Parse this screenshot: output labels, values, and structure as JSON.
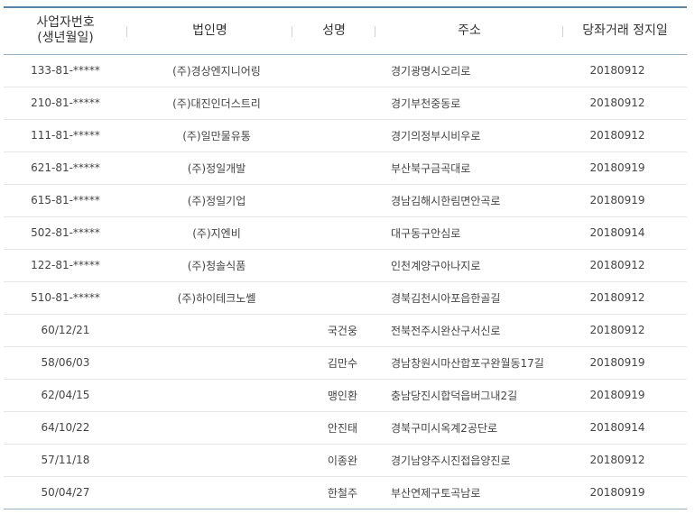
{
  "table": {
    "headers": {
      "biz_no_line1": "사업자번호",
      "biz_no_line2": "(생년월일)",
      "corp_name": "법인명",
      "person_name": "성명",
      "address": "주소",
      "suspend_date": "당좌거래 정지일"
    },
    "rows": [
      {
        "biz_no": "133-81-*****",
        "corp": "(주)경상엔지니어링",
        "name": "",
        "addr": "경기광명시오리로",
        "date": "20180912"
      },
      {
        "biz_no": "210-81-*****",
        "corp": "(주)대진인더스트리",
        "name": "",
        "addr": "경기부천중동로",
        "date": "20180912"
      },
      {
        "biz_no": "111-81-*****",
        "corp": "(주)일만물유통",
        "name": "",
        "addr": "경기의정부시비우로",
        "date": "20180912"
      },
      {
        "biz_no": "621-81-*****",
        "corp": "(주)정일개발",
        "name": "",
        "addr": "부산북구금곡대로",
        "date": "20180919"
      },
      {
        "biz_no": "615-81-*****",
        "corp": "(주)정일기업",
        "name": "",
        "addr": "경남김해시한림면안곡로",
        "date": "20180919"
      },
      {
        "biz_no": "502-81-*****",
        "corp": "(주)지엔비",
        "name": "",
        "addr": "대구동구안심로",
        "date": "20180914"
      },
      {
        "biz_no": "122-81-*****",
        "corp": "(주)청솔식품",
        "name": "",
        "addr": "인천계양구아나지로",
        "date": "20180912"
      },
      {
        "biz_no": "510-81-*****",
        "corp": "(주)하이테크노쎌",
        "name": "",
        "addr": "경북김천시아포읍한골길",
        "date": "20180912"
      },
      {
        "biz_no": "60/12/21",
        "corp": "",
        "name": "국건웅",
        "addr": "전북전주시완산구서신로",
        "date": "20180912"
      },
      {
        "biz_no": "58/06/03",
        "corp": "",
        "name": "김만수",
        "addr": "경남창원시마산합포구완월동17길",
        "date": "20180919"
      },
      {
        "biz_no": "62/04/15",
        "corp": "",
        "name": "맹인환",
        "addr": "충남당진시합덕읍버그내2길",
        "date": "20180919"
      },
      {
        "biz_no": "64/10/22",
        "corp": "",
        "name": "안진태",
        "addr": "경북구미시옥계2공단로",
        "date": "20180914"
      },
      {
        "biz_no": "57/11/18",
        "corp": "",
        "name": "이종완",
        "addr": "경기남양주시진접읍양진로",
        "date": "20180912"
      },
      {
        "biz_no": "50/04/27",
        "corp": "",
        "name": "한철주",
        "addr": "부산연제구토곡남로",
        "date": "20180919"
      }
    ]
  }
}
